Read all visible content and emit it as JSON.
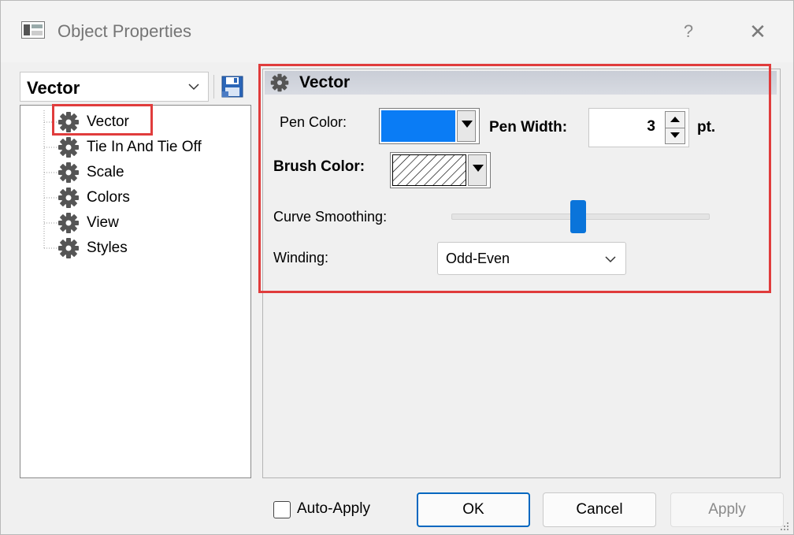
{
  "window": {
    "title": "Object Properties",
    "help_glyph": "?",
    "close_glyph": "✕"
  },
  "object_selector": {
    "value": "Vector"
  },
  "tree": {
    "items": [
      {
        "label": "Vector",
        "selected": true
      },
      {
        "label": "Tie In And Tie Off"
      },
      {
        "label": "Scale"
      },
      {
        "label": "Colors"
      },
      {
        "label": "View"
      },
      {
        "label": "Styles"
      }
    ]
  },
  "panel": {
    "title": "Vector",
    "pen_color_label": "Pen Color:",
    "pen_color_value": "#0a7cf5",
    "pen_width_label": "Pen Width:",
    "pen_width_value": "3",
    "pen_width_unit": "pt.",
    "brush_color_label": "Brush Color:",
    "brush_pattern": "diagonal-hatch",
    "curve_smoothing_label": "Curve Smoothing:",
    "curve_smoothing_level": 0.49,
    "winding_label": "Winding:",
    "winding_value": "Odd-Even"
  },
  "footer": {
    "auto_apply_label": "Auto-Apply",
    "auto_apply_checked": false,
    "ok_label": "OK",
    "cancel_label": "Cancel",
    "apply_label": "Apply"
  },
  "colors": {
    "accent": "#0067c0",
    "highlight": "#e03c3c",
    "slider_thumb": "#0a74da"
  }
}
